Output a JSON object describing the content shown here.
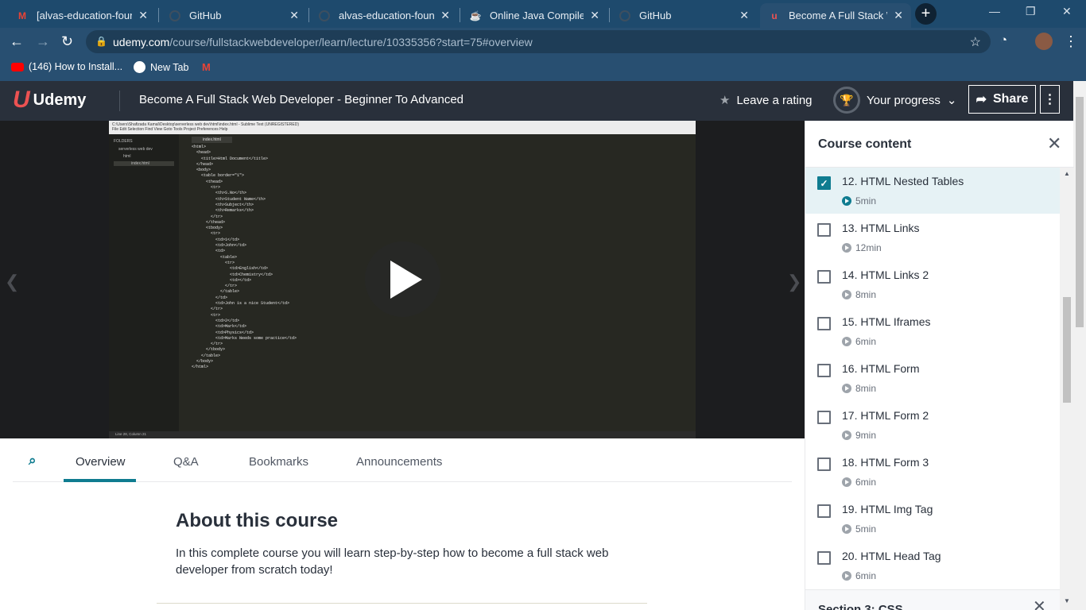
{
  "browser": {
    "tabs": [
      {
        "title": "[alvas-education-found",
        "icon": "gmail-icon"
      },
      {
        "title": "GitHub",
        "icon": "github-icon"
      },
      {
        "title": "alvas-education-founda",
        "icon": "github-icon"
      },
      {
        "title": "Online Java Compiler - ",
        "icon": "java-icon"
      },
      {
        "title": "GitHub",
        "icon": "github-icon"
      },
      {
        "title": "Become A Full Stack We",
        "icon": "udemy-icon"
      }
    ],
    "url_host": "udemy.com",
    "url_path": "/course/fullstackwebdeveloper/learn/lecture/10335356?start=75#overview",
    "bookmarks": [
      {
        "label": "(146) How to Install..."
      },
      {
        "label": "New Tab"
      }
    ]
  },
  "header": {
    "logo_text": "Udemy",
    "course_title": "Become A Full Stack Web Developer - Beginner To Advanced",
    "rating_label": "Leave a rating",
    "progress_label": "Your progress",
    "share_label": "Share"
  },
  "editor": {
    "folders_label": "FOLDERS",
    "folder_name": "serverless web dev",
    "subfolder": "html",
    "file": "index.html",
    "tab": "index.html",
    "status": "Line 28, Column 21",
    "title_path": "C:\\Users\\Shafizada Kamal\\Desktop\\serverless web dev\\html\\index.html - Sublime Text (UNREGISTERED)",
    "menu": "File  Edit  Selection  Find  View  Goto  Tools  Project  Preferences  Help",
    "code": [
      "<html>",
      "  <head>",
      "    <title>Html Document</title>",
      "  </head>",
      "  <body>",
      "    <table border=\"1\">",
      "",
      "      <thead>",
      "",
      "        <tr>",
      "          <th>S.No</th>",
      "          <th>Student Name</th>",
      "          <th>Subject</th>",
      "          <th>Remarks</th>",
      "        </tr>",
      "",
      "      </thead>",
      "",
      "      <tbody>",
      "        <tr>",
      "          <td>1</td>",
      "          <td>John</td>",
      "          <td>",
      "            <table>",
      "              <tr>",
      "                <td>English</td>",
      "                <td>Chemistry</td>",
      "                <td></td>",
      "              </tr>",
      "            </table>",
      "          </td>",
      "          <td>John is a nice Student</td>",
      "        </tr>",
      "        <tr>",
      "          <td>2</td>",
      "          <td>Mark</td>",
      "          <td>Physics</td>",
      "          <td>Marks Needs some practice</td>",
      "        </tr>",
      "      </tbody>",
      "    </table>",
      "  </body>",
      "</html>"
    ]
  },
  "tabs": {
    "overview": "Overview",
    "qa": "Q&A",
    "bookmarks": "Bookmarks",
    "announcements": "Announcements"
  },
  "about": {
    "title": "About this course",
    "description": "In this complete course you will learn step-by-step how to become a full stack web developer from scratch today!"
  },
  "sidebar": {
    "title": "Course content",
    "lectures": [
      {
        "title": "12. HTML Nested Tables",
        "duration": "5min",
        "checked": true
      },
      {
        "title": "13. HTML Links",
        "duration": "12min",
        "checked": false
      },
      {
        "title": "14. HTML Links 2",
        "duration": "8min",
        "checked": false
      },
      {
        "title": "15. HTML Iframes",
        "duration": "6min",
        "checked": false
      },
      {
        "title": "16. HTML Form",
        "duration": "8min",
        "checked": false
      },
      {
        "title": "17. HTML Form 2",
        "duration": "9min",
        "checked": false
      },
      {
        "title": "18. HTML Form 3",
        "duration": "6min",
        "checked": false
      },
      {
        "title": "19. HTML Img Tag",
        "duration": "5min",
        "checked": false
      },
      {
        "title": "20. HTML Head Tag",
        "duration": "6min",
        "checked": false
      }
    ],
    "next_section": "Section 3: CSS"
  },
  "colors": {
    "accent": "#0f7c90",
    "brand": "#ec5252",
    "header_bg": "#29303b"
  }
}
